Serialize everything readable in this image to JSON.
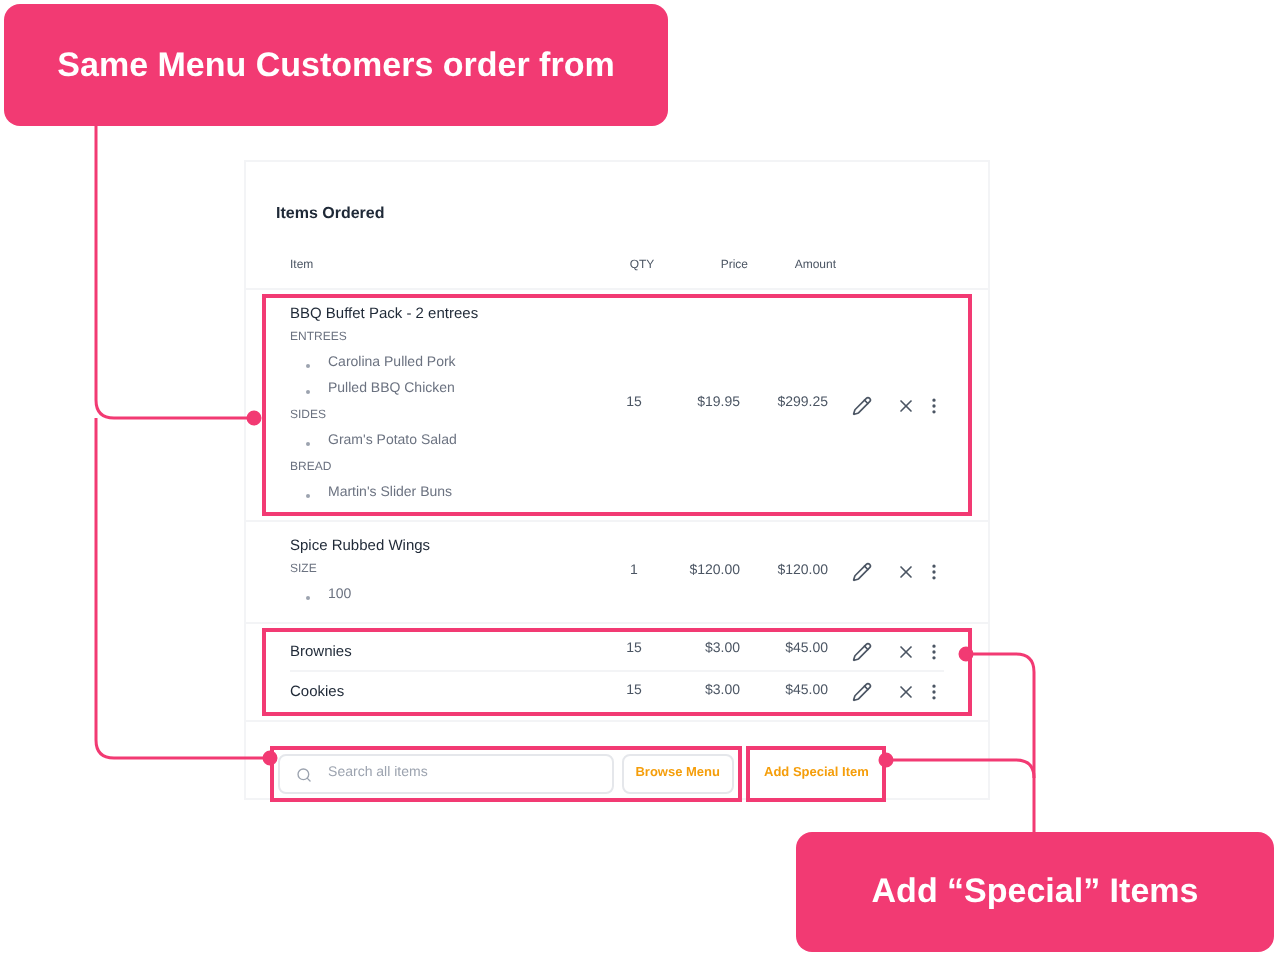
{
  "callouts": [
    {
      "text": "Same Menu Customers order from"
    },
    {
      "text": "Add “Special” Items"
    }
  ],
  "card": {
    "title": "Items Ordered",
    "columns": [
      "Item",
      "QTY",
      "Price",
      "Amount"
    ]
  },
  "rows": [
    {
      "name": "BBQ Buffet Pack - 2 entrees",
      "framed": true,
      "groups": [
        {
          "label": "ENTREES",
          "items": [
            "Carolina Pulled Pork",
            "Pulled BBQ Chicken"
          ]
        },
        {
          "label": "SIDES",
          "items": [
            "Gram's Potato Salad"
          ]
        },
        {
          "label": "BREAD",
          "items": [
            "Martin's Slider Buns"
          ]
        }
      ],
      "qty": "15",
      "price": "$19.95",
      "amount": "$299.25"
    },
    {
      "name": "Spice Rubbed Wings",
      "framed": false,
      "groups": [
        {
          "label": "SIZE",
          "items": [
            "100"
          ]
        }
      ],
      "qty": "1",
      "price": "$120.00",
      "amount": "$120.00"
    },
    {
      "name": "Brownies",
      "framed": true,
      "groups": [],
      "qty": "15",
      "price": "$3.00",
      "amount": "$45.00"
    },
    {
      "name": "Cookies",
      "framed": true,
      "groups": [],
      "qty": "15",
      "price": "$3.00",
      "amount": "$45.00"
    }
  ],
  "footer": {
    "search_placeholder": "Search all items",
    "browse_button": "Browse Menu",
    "special_button": "Add Special Item"
  }
}
